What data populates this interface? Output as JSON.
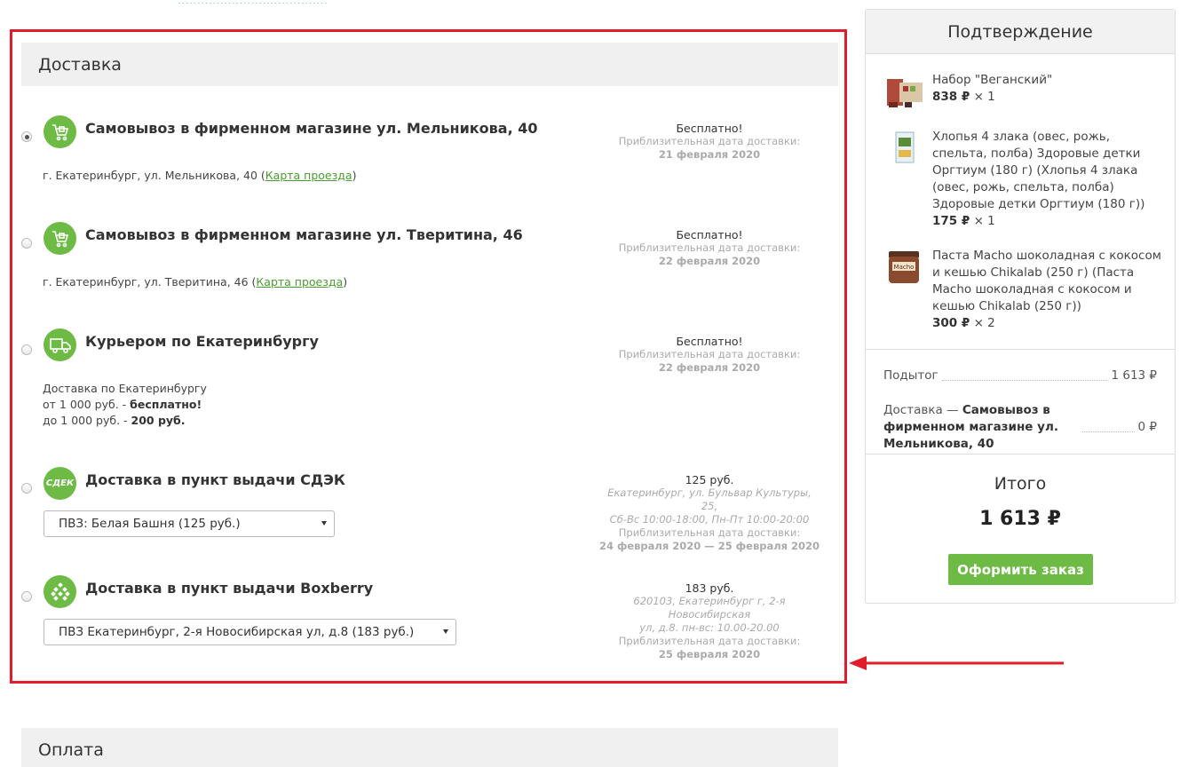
{
  "top_text": "…………………………………",
  "delivery": {
    "title": "Доставка",
    "options": [
      {
        "title": "Самовывоз в фирменном магазине ул. Мельникова, 40",
        "address": "г. Екатеринбург, ул. Мельникова, 40 (",
        "map_link": "Карта проезда",
        "address_end": ")",
        "price": "Бесплатно!",
        "date_label": "Приблизительная дата доставки:",
        "date": "21 февраля 2020",
        "icon": "pickup-cart-icon",
        "selected": true
      },
      {
        "title": "Самовывоз в фирменном магазине ул. Тверитина, 46",
        "address": "г. Екатеринбург, ул. Тверитина, 46 (",
        "map_link": "Карта проезда",
        "address_end": ")",
        "price": "Бесплатно!",
        "date_label": "Приблизительная дата доставки:",
        "date": "22 февраля 2020",
        "icon": "pickup-cart-icon",
        "selected": false
      },
      {
        "title": "Курьером по Екатеринбургу",
        "desc_line1": "Доставка по Екатеринбургу",
        "desc_line2_a": "от 1 000 руб. - ",
        "desc_line2_b": "бесплатно!",
        "desc_line3_a": "до 1 000 руб. - ",
        "desc_line3_b": "200 руб.",
        "price": "Бесплатно!",
        "date_label": "Приблизительная дата доставки:",
        "date": "22 февраля 2020",
        "icon": "courier-truck-icon",
        "selected": false
      },
      {
        "title": "Доставка в пункт выдачи СДЭК",
        "price": "125 руб.",
        "address_line1": "Екатеринбург, ул. Бульвар Культуры, 25,",
        "address_line2": "Сб-Вс 10:00-18:00, Пн-Пт 10:00-20:00",
        "date_label": "Приблизительная дата доставки:",
        "date": "24 февраля 2020 — 25 февраля 2020",
        "select_value": "ПВЗ: Белая Башня (125 руб.)",
        "icon": "cdek-logo-icon",
        "icon_text": "СДЕК",
        "selected": false
      },
      {
        "title": "Доставка в пункт выдачи Boxberry",
        "price": "183 руб.",
        "address_line1": "620103, Екатеринбург г, 2-я Новосибирская",
        "address_line2": "ул, д.8. пн-вс: 10.00-20.00",
        "date_label": "Приблизительная дата доставки:",
        "date": "25 февраля 2020",
        "select_value": "ПВЗ Екатеринбург, 2-я Новосибирская ул, д.8 (183 руб.)",
        "icon": "boxberry-logo-icon",
        "selected": false
      }
    ]
  },
  "payment": {
    "title": "Оплата"
  },
  "confirmation": {
    "title": "Подтверждение",
    "items": [
      {
        "name": "Набор \"Веганский\"",
        "price": "838 ₽",
        "qty": "× 1"
      },
      {
        "name": "Хлопья 4 злака (овес, рожь, спельта, полба) Здоровые детки Оргтиум (180 г) (Хлопья 4 злака (овес, рожь, спельта, полба) Здоровые детки Оргтиум (180 г))",
        "price": "175 ₽",
        "qty": "× 1"
      },
      {
        "name": "Паста Macho шоколадная с кокосом и кешью Chikalab (250 г) (Паста Macho шоколадная с кокосом и кешью Chikalab (250 г))",
        "price": "300 ₽",
        "qty": "× 2",
        "img_text": "Macho"
      }
    ],
    "subtotal_label": "Подытог",
    "subtotal_value": "1 613 ₽",
    "delivery_label": "Доставка — ",
    "delivery_name": "Самовывоз в фирменном магазине ул. Мельникова, 40",
    "delivery_value": "0 ₽",
    "total_label": "Итого",
    "total_value": "1 613 ₽",
    "order_button": "Оформить заказ"
  },
  "colors": {
    "accent": "#6dbb44",
    "highlight": "#e11d2b",
    "link": "#4a9c2d"
  }
}
